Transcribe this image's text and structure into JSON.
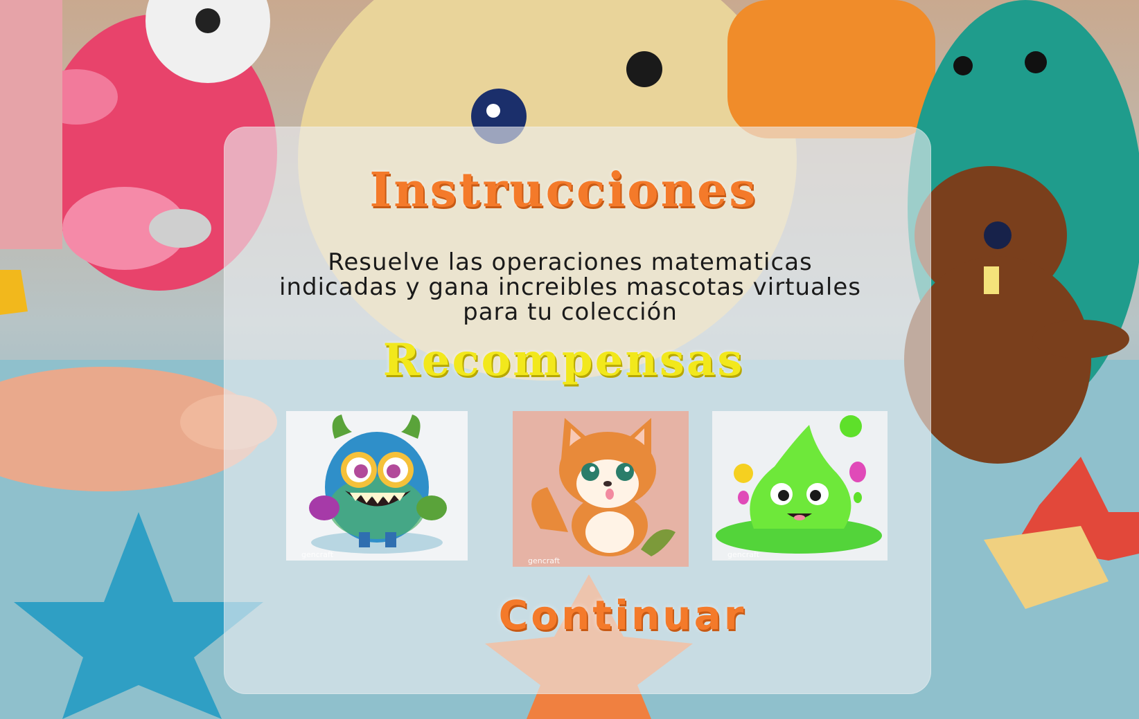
{
  "screen": {
    "title": "Instrucciones",
    "instructions": "Resuelve las operaciones matematicas indicadas y gana increibles mascotas virtuales para tu colección",
    "rewards_title": "Recompensas",
    "continue_label": "Continuar"
  },
  "rewards": [
    {
      "name": "blue-furry-monster",
      "watermark": "gencraft"
    },
    {
      "name": "orange-fox-pup",
      "watermark": "gencraft"
    },
    {
      "name": "green-slime",
      "watermark": "gencraft"
    }
  ],
  "colors": {
    "title": "#f47a2a",
    "rewards_title": "#f2e81c",
    "continue": "#f47a2a",
    "panel": "rgba(235,238,240,0.62)"
  }
}
